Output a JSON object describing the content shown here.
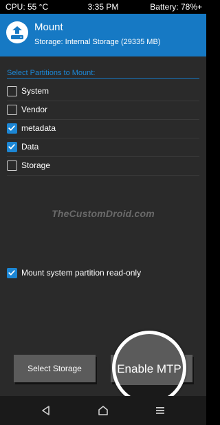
{
  "status": {
    "cpu": "CPU: 55 °C",
    "time": "3:35 PM",
    "battery": "Battery: 78%+"
  },
  "header": {
    "title": "Mount",
    "subtitle": "Storage: Internal Storage (29335 MB)",
    "icon": "mount-drive-icon"
  },
  "partitions": {
    "label": "Select Partitions to Mount:",
    "items": [
      {
        "label": "System",
        "checked": false
      },
      {
        "label": "Vendor",
        "checked": false
      },
      {
        "label": "metadata",
        "checked": true
      },
      {
        "label": "Data",
        "checked": true
      },
      {
        "label": "Storage",
        "checked": false
      }
    ]
  },
  "watermark": "TheCustomDroid.com",
  "readonly": {
    "label": "Mount system partition read-only",
    "checked": true
  },
  "buttons": {
    "select_storage": "Select Storage",
    "enable_mtp": "Enable MTP"
  },
  "navbar": {
    "back_icon": "back-triangle-icon",
    "home_icon": "home-icon",
    "menu_icon": "menu-icon"
  },
  "colors": {
    "accent": "#1679c4",
    "checkbox": "#1c86d4",
    "background": "#2a2a2a",
    "button": "#5b5b5b"
  }
}
